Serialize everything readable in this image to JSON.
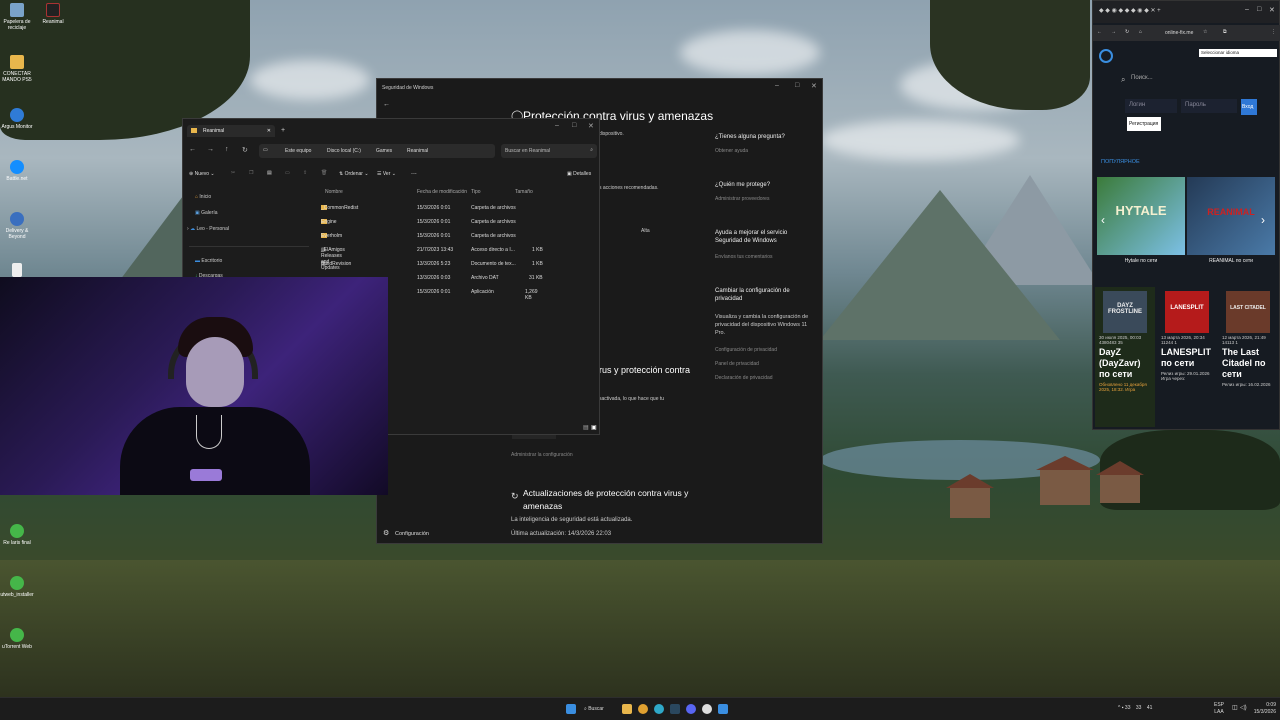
{
  "desktop": {
    "icons": [
      {
        "label": "Papelera de reciclaje"
      },
      {
        "label": "Reanimal"
      },
      {
        "label": "CONECTAR MANDO PS5"
      },
      {
        "label": "Argus Monitor"
      },
      {
        "label": "Battle.net"
      },
      {
        "label": "Delivery & Beyond"
      },
      {
        "label": "Re laris final"
      },
      {
        "label": "utweb_installer"
      },
      {
        "label": "uTorrent Web"
      }
    ]
  },
  "security": {
    "window_title": "Seguridad de Windows",
    "heading": "Protección contra virus y amenazas",
    "partial_lines": [
      "dispositivo.",
      "s acciones recomendadas.",
      "Alta"
    ],
    "protection_heading": "rus y protección contra",
    "protection_text": "sactivada, lo que hace que tu",
    "manage_link": "Administrar la configuración",
    "updates_heading": "Actualizaciones de protección contra virus y amenazas",
    "updates_text": "La inteligencia de seguridad está actualizada.",
    "last_update": "Última actualización: 14/3/2026 22:03",
    "settings_label": "Configuración",
    "side": {
      "q1": "¿Tienes alguna pregunta?",
      "q1_link": "Obtener ayuda",
      "q2": "¿Quién me protege?",
      "q2_link": "Administrar proveedores",
      "q3": "Ayuda a mejorar el servicio Seguridad de Windows",
      "q3_link": "Envíanos tus comentarios",
      "q4": "Cambiar la configuración de privacidad",
      "q4_text": "Visualiza y cambia la configuración de privacidad del dispositivo Windows 11 Pro.",
      "links": [
        "Configuración de privacidad",
        "Panel de privacidad",
        "Declaración de privacidad"
      ]
    }
  },
  "explorer": {
    "tab_title": "Reanimal",
    "breadcrumb": [
      "Este equipo",
      "Disco local (C:)",
      "Games",
      "Reanimal"
    ],
    "search_placeholder": "Buscar en Reanimal",
    "toolbar": {
      "new": "Nuevo",
      "sort": "Ordenar",
      "view": "Ver",
      "more": "...",
      "details": "Detalles"
    },
    "nav": [
      "Inicio",
      "Galería",
      "Leo - Personal",
      "Escritorio",
      "Descargas"
    ],
    "columns": [
      "Nombre",
      "Fecha de modificación",
      "Tipo",
      "Tamaño"
    ],
    "rows": [
      {
        "name": "_CommonRedist",
        "date": "15/3/2026 0:01",
        "type": "Carpeta de archivos",
        "size": ""
      },
      {
        "name": "Engine",
        "date": "15/3/2026 0:01",
        "type": "Carpeta de archivos",
        "size": ""
      },
      {
        "name": "Everholm",
        "date": "15/3/2026 0:01",
        "type": "Carpeta de archivos",
        "size": ""
      },
      {
        "name": "_ElAmigos Releases and Updates",
        "date": "21/7/2023 13:43",
        "type": "Acceso directo a I...",
        "size": "1 KB"
      },
      {
        "name": "BuildRevision",
        "date": "13/3/2026 5:23",
        "type": "Documento de tex...",
        "size": "1 KB"
      },
      {
        "name": "",
        "date": "13/3/2026 0:03",
        "type": "Archivo DAT",
        "size": "31 KB"
      },
      {
        "name": "",
        "date": "15/3/2026 0:01",
        "type": "Aplicación",
        "size": "1,269 KB"
      }
    ]
  },
  "browser": {
    "url": "online-fix.me",
    "lang_select": "Seleccionar idioma",
    "search_placeholder": "Поиск...",
    "login_placeholder": "Логин",
    "password_placeholder": "Пароль",
    "login_button": "Вход",
    "register_button": "Регистрация",
    "popular_label": "ПОПУЛЯРНОЕ",
    "featured": [
      {
        "title": "Hytale по сети",
        "logo": "HYTALE"
      },
      {
        "title": "REANIMAL по сети",
        "logo": "REANIMAL"
      }
    ],
    "cards": [
      {
        "title": "DayZ (DayZavr) по сети",
        "meta": "30 июля 2025, 00:03",
        "stats": "4380483 35",
        "note": "Обновлено 11 декабря 2025, 18:32. Игра",
        "cover": "DAYZ FROSTLINE"
      },
      {
        "title": "LANESPLIT по сети",
        "meta": "13 марта 2026, 20:34",
        "stats": "11244 1",
        "note": "Релиз игры: 29.01.2026 Игра через:",
        "cover": "LANESPLIT"
      },
      {
        "title": "The Last Citadel по сети",
        "meta": "12 марта 2026, 21:49",
        "stats": "14113 1",
        "note": "Релиз игры: 16.02.2026",
        "cover": "LAST CITADEL"
      }
    ]
  },
  "taskbar": {
    "search": "Buscar",
    "lang": "ESP",
    "lang2": "LAA",
    "time": "0:09",
    "date": "15/3/2026",
    "tray_nums": [
      "33",
      "33",
      "41"
    ]
  }
}
